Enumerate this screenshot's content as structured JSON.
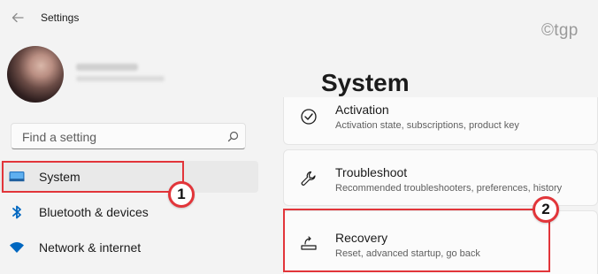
{
  "window": {
    "title": "Settings"
  },
  "watermark": "©tgp",
  "search": {
    "placeholder": "Find a setting"
  },
  "sidebar": {
    "items": [
      {
        "label": "System",
        "icon": "monitor-icon"
      },
      {
        "label": "Bluetooth & devices",
        "icon": "bluetooth-icon"
      },
      {
        "label": "Network & internet",
        "icon": "wifi-icon"
      }
    ]
  },
  "main": {
    "title": "System",
    "cards": [
      {
        "title": "Activation",
        "description": "Activation state, subscriptions, product key",
        "icon": "check-circle-icon"
      },
      {
        "title": "Troubleshoot",
        "description": "Recommended troubleshooters, preferences, history",
        "icon": "wrench-icon"
      },
      {
        "title": "Recovery",
        "description": "Reset, advanced startup, go back",
        "icon": "recovery-icon"
      }
    ]
  },
  "annotations": {
    "step1": "1",
    "step2": "2"
  },
  "colors": {
    "highlight": "#e2353a",
    "accent": "#0067c0",
    "active_bg": "#e9e9e9"
  }
}
